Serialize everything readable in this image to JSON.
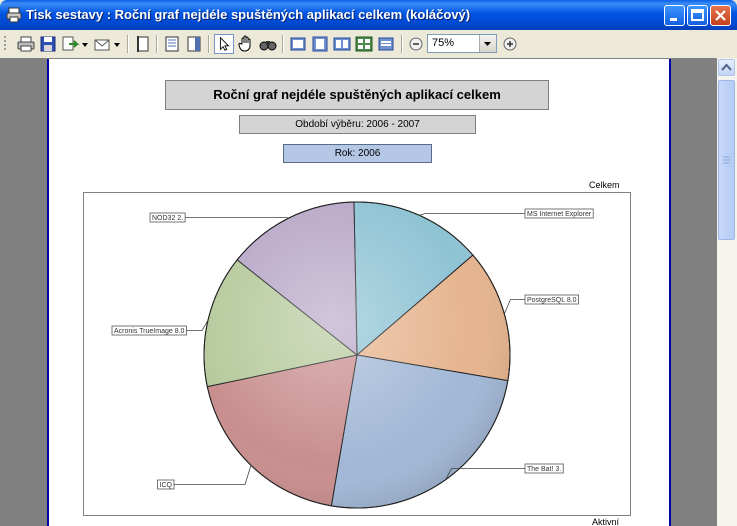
{
  "window": {
    "title": "Tisk sestavy : Roční graf nejdéle spuštěných aplikací celkem (koláčový)"
  },
  "toolbar": {
    "zoom_value": "75%"
  },
  "report": {
    "title": "Roční graf nejdéle spuštěných aplikací celkem",
    "period_label": "Období výběru:  2006  -  2007",
    "year_label": "Rok:  2006",
    "top_right_label": "Celkem",
    "bottom_right_label": "Aktivní"
  },
  "chart_data": {
    "type": "pie",
    "slices": [
      {
        "label": "MS Internet Explorer",
        "value": 14,
        "color": "#8ec3d4"
      },
      {
        "label": "PostgreSQL  8.0",
        "value": 14,
        "color": "#e6b48e"
      },
      {
        "label": "The Bat!  3.",
        "value": 25,
        "color": "#a2b8d6"
      },
      {
        "label": "ICQ",
        "value": 19,
        "color": "#c98e8e"
      },
      {
        "label": "Acronis TrueImage  8.0",
        "value": 14,
        "color": "#b6c99c"
      },
      {
        "label": "NOD32  2.",
        "value": 14,
        "color": "#b8a8c8"
      }
    ]
  }
}
